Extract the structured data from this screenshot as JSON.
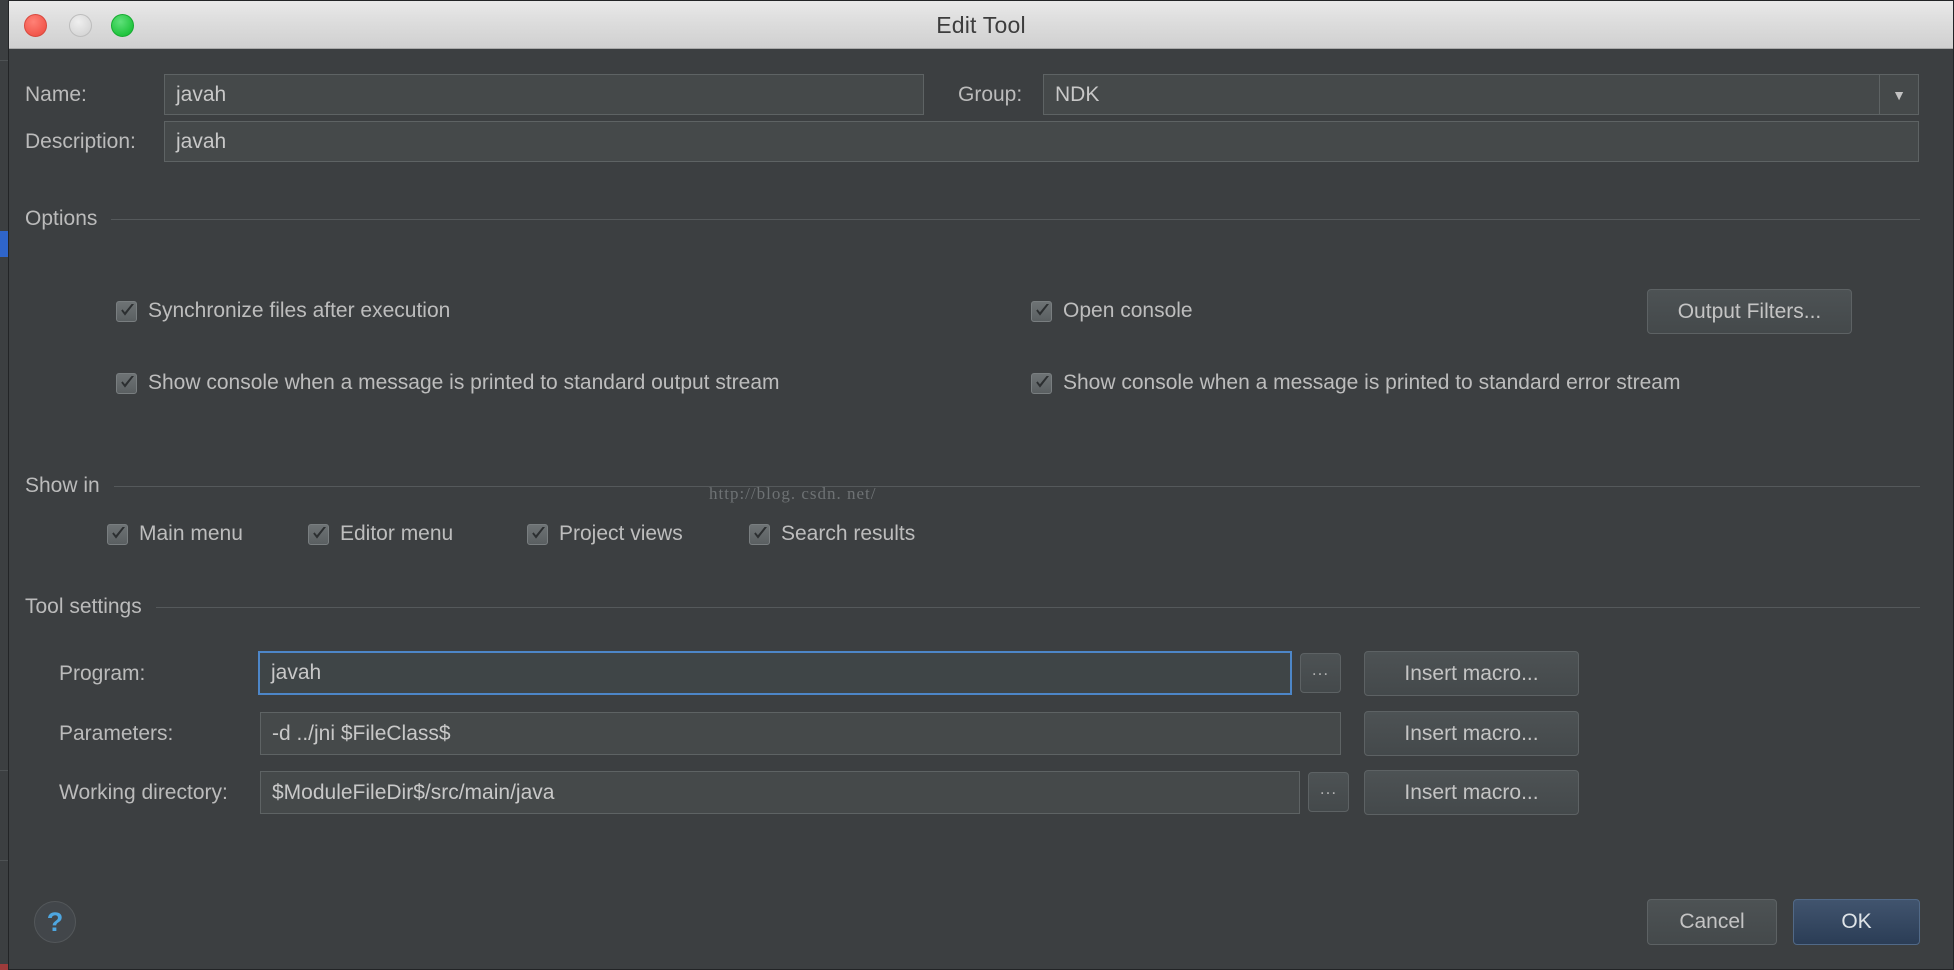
{
  "window": {
    "title": "Edit Tool",
    "traffic_lights": [
      "close-button",
      "minimize-button",
      "maximize-button"
    ]
  },
  "watermark": "http://blog. csdn. net/",
  "form": {
    "name_label": "Name:",
    "name_value": "javah",
    "group_label": "Group:",
    "group_value": "NDK",
    "group_options": [
      "NDK"
    ],
    "description_label": "Description:",
    "description_value": "javah"
  },
  "options": {
    "section_label": "Options",
    "checkboxes": [
      {
        "label": "Synchronize files after execution",
        "checked": true
      },
      {
        "label": "Open console",
        "checked": true
      },
      {
        "label": "Show console when a message is printed to standard output stream",
        "checked": true
      },
      {
        "label": "Show console when a message is printed to standard error stream",
        "checked": true
      }
    ],
    "output_filters_label": "Output Filters..."
  },
  "show_in": {
    "section_label": "Show in",
    "checkboxes": [
      {
        "label": "Main menu",
        "checked": true
      },
      {
        "label": "Editor menu",
        "checked": true
      },
      {
        "label": "Project views",
        "checked": true
      },
      {
        "label": "Search results",
        "checked": true
      }
    ]
  },
  "tool_settings": {
    "section_label": "Tool settings",
    "rows": [
      {
        "label": "Program:",
        "value": "javah",
        "focused": true,
        "browse_label": "...",
        "macro_label": "Insert macro..."
      },
      {
        "label": "Parameters:",
        "value": "-d ../jni $FileClass$",
        "focused": false,
        "browse_label": "",
        "macro_label": "Insert macro..."
      },
      {
        "label": "Working directory:",
        "value": "$ModuleFileDir$/src/main/java",
        "focused": false,
        "browse_label": "...",
        "macro_label": "Insert macro..."
      }
    ]
  },
  "footer": {
    "help_label": "?",
    "cancel_label": "Cancel",
    "ok_label": "OK"
  },
  "colors": {
    "dialog_bg": "#3c3f41",
    "field_bg": "#45494a",
    "accent_focus": "#4d86c8",
    "default_button": "#2b3d56",
    "help_icon": "#4ea6e0",
    "text": "#bbbbbb"
  }
}
